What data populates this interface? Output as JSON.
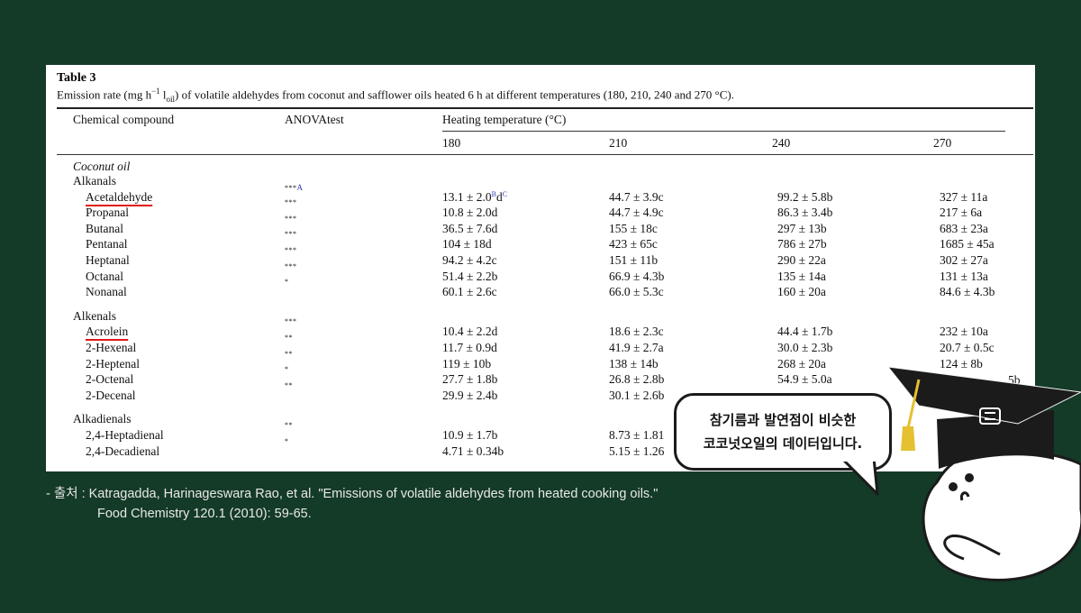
{
  "table": {
    "label": "Table 3",
    "caption_html": "Emission rate (mg h<sup style=\"font-size:9px\">&minus;1</sup> l<sub style=\"font-size:9px\">oil</sub>) of volatile aldehydes from coconut and safflower oils heated 6 h at different temperatures (180, 210, 240 and 270 &deg;C).",
    "headers": {
      "compound": "Chemical compound",
      "anova": "ANOVAtest",
      "heating": "Heating temperature (°C)",
      "temps": [
        "180",
        "210",
        "240",
        "270"
      ]
    },
    "oil": "Coconut oil",
    "groups": [
      {
        "name": "Alkanals",
        "rows": [
          {
            "compound": "Acetaldehyde",
            "sig": "***",
            "sig_sup": "A",
            "values": [
              "13.1 ± 2.0",
              "44.7 ± 3.9c",
              "99.2 ± 5.8b",
              "327 ± 11a"
            ],
            "first_sup": {
              "b": "B",
              "d": "d",
              "c": "C"
            }
          },
          {
            "compound": "Propanal",
            "sig": "***",
            "values": [
              "10.8 ± 2.0d",
              "44.7 ± 4.9c",
              "86.3 ± 3.4b",
              "217 ± 6a"
            ]
          },
          {
            "compound": "Butanal",
            "sig": "***",
            "values": [
              "36.5 ± 7.6d",
              "155 ± 18c",
              "297 ± 13b",
              "683 ± 23a"
            ]
          },
          {
            "compound": "Pentanal",
            "sig": "***",
            "values": [
              "104 ± 18d",
              "423 ± 65c",
              "786 ± 27b",
              "1685 ± 45a"
            ]
          },
          {
            "compound": "Heptanal",
            "sig": "***",
            "values": [
              "94.2 ± 4.2c",
              "151 ± 11b",
              "290 ± 22a",
              "302 ± 27a"
            ]
          },
          {
            "compound": "Octanal",
            "sig": "***",
            "values": [
              "51.4 ± 2.2b",
              "66.9 ± 4.3b",
              "135 ± 14a",
              "131 ± 13a"
            ]
          },
          {
            "compound": "Nonanal",
            "sig": "*",
            "values": [
              "60.1 ± 2.6c",
              "66.0 ± 5.3c",
              "160 ± 20a",
              "84.6 ± 4.3b"
            ]
          }
        ]
      },
      {
        "name": "Alkenals",
        "rows": [
          {
            "compound": "Acrolein",
            "sig": "***",
            "values": [
              "10.4 ± 2.2d",
              "18.6 ± 2.3c",
              "44.4 ± 1.7b",
              "232 ± 10a"
            ]
          },
          {
            "compound": "2-Hexenal",
            "sig": "**",
            "values": [
              "11.7 ± 0.9d",
              "41.9 ± 2.7a",
              "30.0 ± 2.3b",
              "20.7 ± 0.5c"
            ]
          },
          {
            "compound": "2-Heptenal",
            "sig": "**",
            "values": [
              "119 ± 10b",
              "138 ± 14b",
              "268 ± 20a",
              "124 ± 8b"
            ]
          },
          {
            "compound": "2-Octenal",
            "sig": "*",
            "values": [
              "27.7 ± 1.8b",
              "26.8 ± 2.8b",
              "54.9 ± 5.0a",
              ""
            ]
          },
          {
            "compound": "2-Decenal",
            "sig": "**",
            "values": [
              "29.9 ± 2.4b",
              "30.1 ± 2.6b",
              "",
              ""
            ]
          }
        ]
      },
      {
        "name": "Alkadienals",
        "rows": [
          {
            "compound": "2,4-Heptadienal",
            "sig": "**",
            "values": [
              "10.9 ± 1.7b",
              "8.73 ± 1.81",
              "",
              ""
            ]
          },
          {
            "compound": "2,4-Decadienal",
            "sig": "*",
            "values": [
              "4.71 ± 0.34b",
              "5.15 ± 1.26",
              "",
              ""
            ]
          }
        ]
      }
    ],
    "partial_270_octenal": "5b"
  },
  "source": {
    "prefix": "- 출처 :",
    "line1": "Katragadda, Harinageswara Rao, et al. \"Emissions of volatile aldehydes from heated cooking oils.\"",
    "line2": "Food Chemistry 120.1 (2010): 59-65."
  },
  "bubble": {
    "line1": "참기름과 발연점이 비슷한",
    "line2": "코코넛오일의 데이터입니다."
  },
  "colors": {
    "background": "#143a28",
    "underline": "#e01818",
    "superscript": "#2b3bb8"
  }
}
